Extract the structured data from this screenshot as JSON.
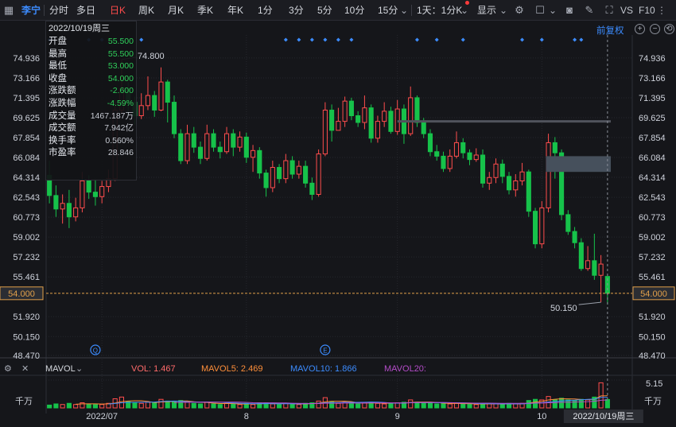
{
  "toolbar": {
    "stock_name": "李宁",
    "periods": [
      "分时",
      "多日",
      "日K",
      "周K",
      "月K",
      "季K",
      "年K",
      "1分",
      "3分",
      "5分",
      "10分",
      "15分"
    ],
    "active_period": "日K",
    "adjust_select": "1天：1分K",
    "display": "显示",
    "vs_label": "VS",
    "f10_label": "F10"
  },
  "adjust_label": "前复权",
  "info": {
    "date": "2022/10/19周三",
    "rows": [
      {
        "label": "开盘",
        "value": "55.500"
      },
      {
        "label": "最高",
        "value": "55.500"
      },
      {
        "label": "最低",
        "value": "53.000"
      },
      {
        "label": "收盘",
        "value": "54.000"
      },
      {
        "label": "涨跌额",
        "value": "-2.600"
      },
      {
        "label": "涨跌幅",
        "value": "-4.59%"
      },
      {
        "label": "成交量",
        "value": "1467.187万"
      },
      {
        "label": "成交额",
        "value": "7.942亿"
      },
      {
        "label": "换手率",
        "value": "0.560%"
      },
      {
        "label": "市盈率",
        "value": "28.846"
      }
    ]
  },
  "volume_legend": {
    "indicator": "MAVOL",
    "vol": "VOL: 1.467",
    "ma5": "MAVOL5: 2.469",
    "ma10": "MAVOL10: 1.866",
    "ma20": "MAVOL20:",
    "axis_top": "5.15",
    "unit": "千万"
  },
  "colors": {
    "up": "#ff4d4d",
    "down": "#16c24a",
    "background": "#15161a",
    "grid": "#25272d",
    "crosshair": "#e2a04a",
    "accent": "#3c8cff",
    "ma5": "#ff8f3a",
    "ma10": "#3c8cff",
    "ma20": "#b44cc9"
  },
  "chart_data": {
    "type": "candlestick",
    "ylim": [
      48.47,
      76.7
    ],
    "price_ticks": [
      "74.936",
      "73.166",
      "71.395",
      "69.625",
      "67.854",
      "66.084",
      "64.314",
      "62.543",
      "60.773",
      "59.002",
      "57.232",
      "55.461",
      "51.920",
      "50.150",
      "48.470"
    ],
    "price_tick_values": [
      74.936,
      73.166,
      71.395,
      69.625,
      67.854,
      66.084,
      64.314,
      62.543,
      60.773,
      59.002,
      57.232,
      55.461,
      51.92,
      50.15,
      48.47
    ],
    "current_price_label": "54.000",
    "crosshair_price": 54.0,
    "max_label": "74.800",
    "min_label": "50.150",
    "month_labels": [
      {
        "label": "2022/07",
        "index": 8
      },
      {
        "label": "8",
        "index": 30
      },
      {
        "label": "9",
        "index": 53
      },
      {
        "label": "10",
        "index": 75
      }
    ],
    "cursor_date_label": "2022/10/19周三",
    "candles": [
      [
        64.5,
        62.7,
        65.8,
        62.0
      ],
      [
        62.7,
        61.5,
        63.6,
        60.8
      ],
      [
        61.5,
        62.0,
        62.8,
        60.2
      ],
      [
        62.0,
        60.8,
        63.2,
        59.8
      ],
      [
        60.8,
        61.6,
        62.5,
        60.4
      ],
      [
        61.6,
        64.0,
        64.8,
        61.2
      ],
      [
        64.0,
        63.0,
        64.5,
        62.4
      ],
      [
        63.0,
        62.6,
        64.2,
        61.8
      ],
      [
        62.6,
        63.5,
        64.0,
        62.0
      ],
      [
        63.5,
        64.2,
        65.0,
        63.0
      ],
      [
        64.2,
        70.3,
        71.2,
        64.0
      ],
      [
        70.3,
        72.2,
        74.8,
        70.0
      ],
      [
        72.2,
        71.0,
        72.8,
        69.8
      ],
      [
        71.0,
        69.8,
        71.5,
        69.0
      ],
      [
        69.8,
        70.7,
        71.8,
        69.5
      ],
      [
        70.7,
        71.6,
        73.3,
        70.3
      ],
      [
        71.6,
        70.3,
        72.0,
        69.7
      ],
      [
        70.3,
        72.8,
        74.1,
        70.2
      ],
      [
        72.8,
        71.0,
        73.0,
        69.2
      ],
      [
        71.0,
        68.2,
        71.6,
        67.8
      ],
      [
        68.2,
        65.8,
        68.6,
        65.5
      ],
      [
        65.8,
        68.2,
        69.0,
        65.5
      ],
      [
        68.2,
        67.0,
        68.8,
        66.5
      ],
      [
        67.0,
        66.0,
        67.5,
        65.5
      ],
      [
        66.0,
        68.2,
        69.0,
        65.8
      ],
      [
        68.2,
        67.0,
        68.6,
        66.6
      ],
      [
        67.0,
        66.6,
        67.5,
        66.0
      ],
      [
        66.6,
        68.2,
        68.8,
        66.4
      ],
      [
        68.2,
        67.0,
        68.6,
        66.2
      ],
      [
        67.0,
        67.9,
        68.4,
        66.6
      ],
      [
        67.9,
        66.1,
        68.3,
        65.6
      ],
      [
        66.1,
        66.7,
        67.2,
        64.8
      ],
      [
        66.7,
        64.7,
        67.0,
        64.2
      ],
      [
        64.7,
        63.4,
        65.0,
        62.6
      ],
      [
        63.4,
        65.2,
        65.8,
        63.0
      ],
      [
        65.2,
        64.2,
        65.5,
        63.8
      ],
      [
        64.2,
        65.8,
        66.4,
        63.8
      ],
      [
        65.8,
        64.6,
        66.2,
        64.2
      ],
      [
        64.6,
        65.3,
        65.8,
        64.2
      ],
      [
        65.3,
        63.8,
        65.8,
        63.4
      ],
      [
        63.8,
        62.8,
        64.3,
        62.3
      ],
      [
        62.8,
        66.4,
        66.8,
        62.6
      ],
      [
        66.4,
        70.3,
        71.0,
        66.2
      ],
      [
        70.3,
        68.5,
        70.8,
        67.5
      ],
      [
        68.5,
        69.3,
        70.5,
        68.5
      ],
      [
        69.3,
        71.1,
        71.5,
        68.8
      ],
      [
        71.1,
        69.8,
        71.4,
        69.4
      ],
      [
        69.8,
        69.2,
        70.2,
        68.8
      ],
      [
        69.2,
        70.5,
        71.6,
        68.6
      ],
      [
        70.5,
        67.8,
        70.8,
        67.4
      ],
      [
        67.8,
        69.3,
        69.8,
        67.4
      ],
      [
        69.3,
        70.2,
        71.0,
        68.8
      ],
      [
        70.2,
        68.4,
        70.6,
        68.2
      ],
      [
        68.4,
        70.4,
        71.2,
        68.1
      ],
      [
        70.4,
        68.2,
        70.8,
        67.3
      ],
      [
        68.2,
        71.4,
        72.4,
        68.0
      ],
      [
        71.4,
        69.2,
        71.6,
        68.8
      ],
      [
        69.2,
        68.2,
        69.6,
        67.8
      ],
      [
        68.2,
        66.6,
        68.6,
        66.2
      ],
      [
        66.6,
        66.2,
        67.2,
        65.8
      ],
      [
        66.2,
        65.1,
        66.6,
        64.8
      ],
      [
        65.1,
        66.2,
        66.8,
        64.8
      ],
      [
        66.2,
        67.4,
        68.4,
        66.0
      ],
      [
        67.4,
        66.5,
        67.8,
        66.0
      ],
      [
        66.5,
        65.9,
        66.8,
        65.4
      ],
      [
        65.9,
        66.3,
        66.9,
        65.7
      ],
      [
        66.3,
        63.8,
        66.8,
        63.4
      ],
      [
        63.8,
        64.3,
        64.8,
        63.2
      ],
      [
        64.3,
        65.5,
        66.0,
        63.8
      ],
      [
        65.5,
        64.4,
        65.9,
        63.8
      ],
      [
        64.4,
        63.2,
        64.8,
        62.8
      ],
      [
        63.2,
        64.0,
        64.6,
        62.6
      ],
      [
        64.0,
        64.8,
        65.6,
        63.6
      ],
      [
        64.8,
        61.3,
        65.0,
        60.8
      ],
      [
        61.3,
        58.4,
        61.6,
        58.0
      ],
      [
        58.4,
        61.6,
        62.2,
        58.0
      ],
      [
        61.6,
        67.4,
        68.2,
        61.2
      ],
      [
        67.4,
        66.5,
        67.9,
        64.2
      ],
      [
        66.5,
        61.0,
        66.8,
        60.5
      ],
      [
        61.0,
        59.5,
        61.4,
        59.2
      ],
      [
        59.5,
        58.5,
        59.9,
        58.0
      ],
      [
        58.5,
        56.2,
        58.9,
        56.0
      ],
      [
        56.2,
        56.9,
        58.2,
        56.0
      ],
      [
        56.9,
        55.6,
        59.3,
        55.2
      ],
      [
        55.6,
        56.6,
        57.4,
        53.2
      ],
      [
        55.5,
        54.0,
        55.5,
        53.0
      ]
    ],
    "volume_ylim": [
      0,
      5.15
    ],
    "volumes": [
      0.5,
      0.7,
      0.6,
      0.8,
      0.6,
      0.9,
      0.7,
      0.6,
      0.6,
      0.8,
      1.6,
      1.9,
      1.1,
      0.9,
      0.8,
      1.0,
      0.9,
      1.5,
      1.2,
      1.1,
      1.3,
      1.0,
      0.8,
      0.7,
      1.0,
      0.7,
      0.6,
      0.8,
      0.7,
      0.6,
      0.8,
      0.6,
      0.9,
      0.9,
      0.7,
      0.6,
      0.8,
      0.7,
      0.6,
      0.8,
      0.9,
      1.2,
      1.8,
      1.1,
      0.8,
      1.0,
      0.8,
      0.7,
      0.9,
      1.0,
      0.8,
      0.7,
      0.8,
      0.9,
      1.0,
      1.4,
      1.0,
      0.8,
      0.9,
      0.7,
      0.8,
      0.7,
      0.8,
      0.7,
      0.7,
      0.6,
      0.8,
      0.7,
      0.7,
      0.6,
      0.8,
      0.7,
      0.8,
      1.3,
      1.5,
      1.4,
      2.0,
      1.4,
      1.7,
      1.4,
      1.3,
      1.5,
      1.4,
      1.9,
      4.4,
      1.467
    ]
  }
}
